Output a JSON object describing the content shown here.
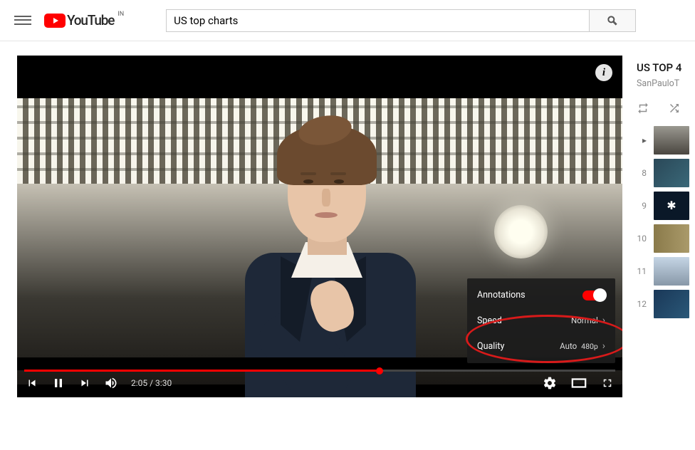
{
  "header": {
    "logo_text": "YouTube",
    "country": "IN",
    "search_value": "US top charts"
  },
  "player": {
    "info_glyph": "i",
    "time_current": "2:05",
    "time_sep": " / ",
    "time_total": "3:30",
    "settings": {
      "annotations_label": "Annotations",
      "speed_label": "Speed",
      "speed_value": "Normal",
      "quality_label": "Quality",
      "quality_value_auto": "Auto",
      "quality_value_res": "480p"
    }
  },
  "sidebar": {
    "title": "US TOP 4",
    "channel": "SanPauloT",
    "items": [
      {
        "num": "▸"
      },
      {
        "num": "8"
      },
      {
        "num": "9"
      },
      {
        "num": "10"
      },
      {
        "num": "11"
      },
      {
        "num": "12"
      }
    ]
  }
}
